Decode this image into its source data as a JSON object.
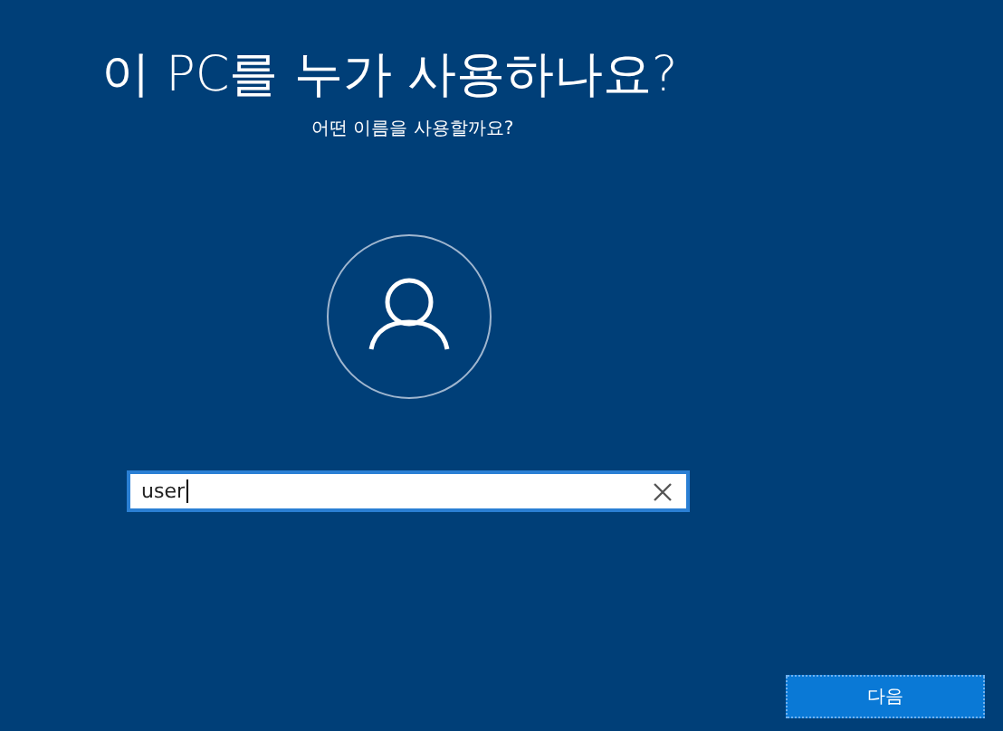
{
  "title": "이 PC를 누가 사용하나요?",
  "subtitle": "어떤 이름을 사용할까요?",
  "name_field": {
    "value": "user"
  },
  "buttons": [
    {
      "label": "다음"
    }
  ]
}
